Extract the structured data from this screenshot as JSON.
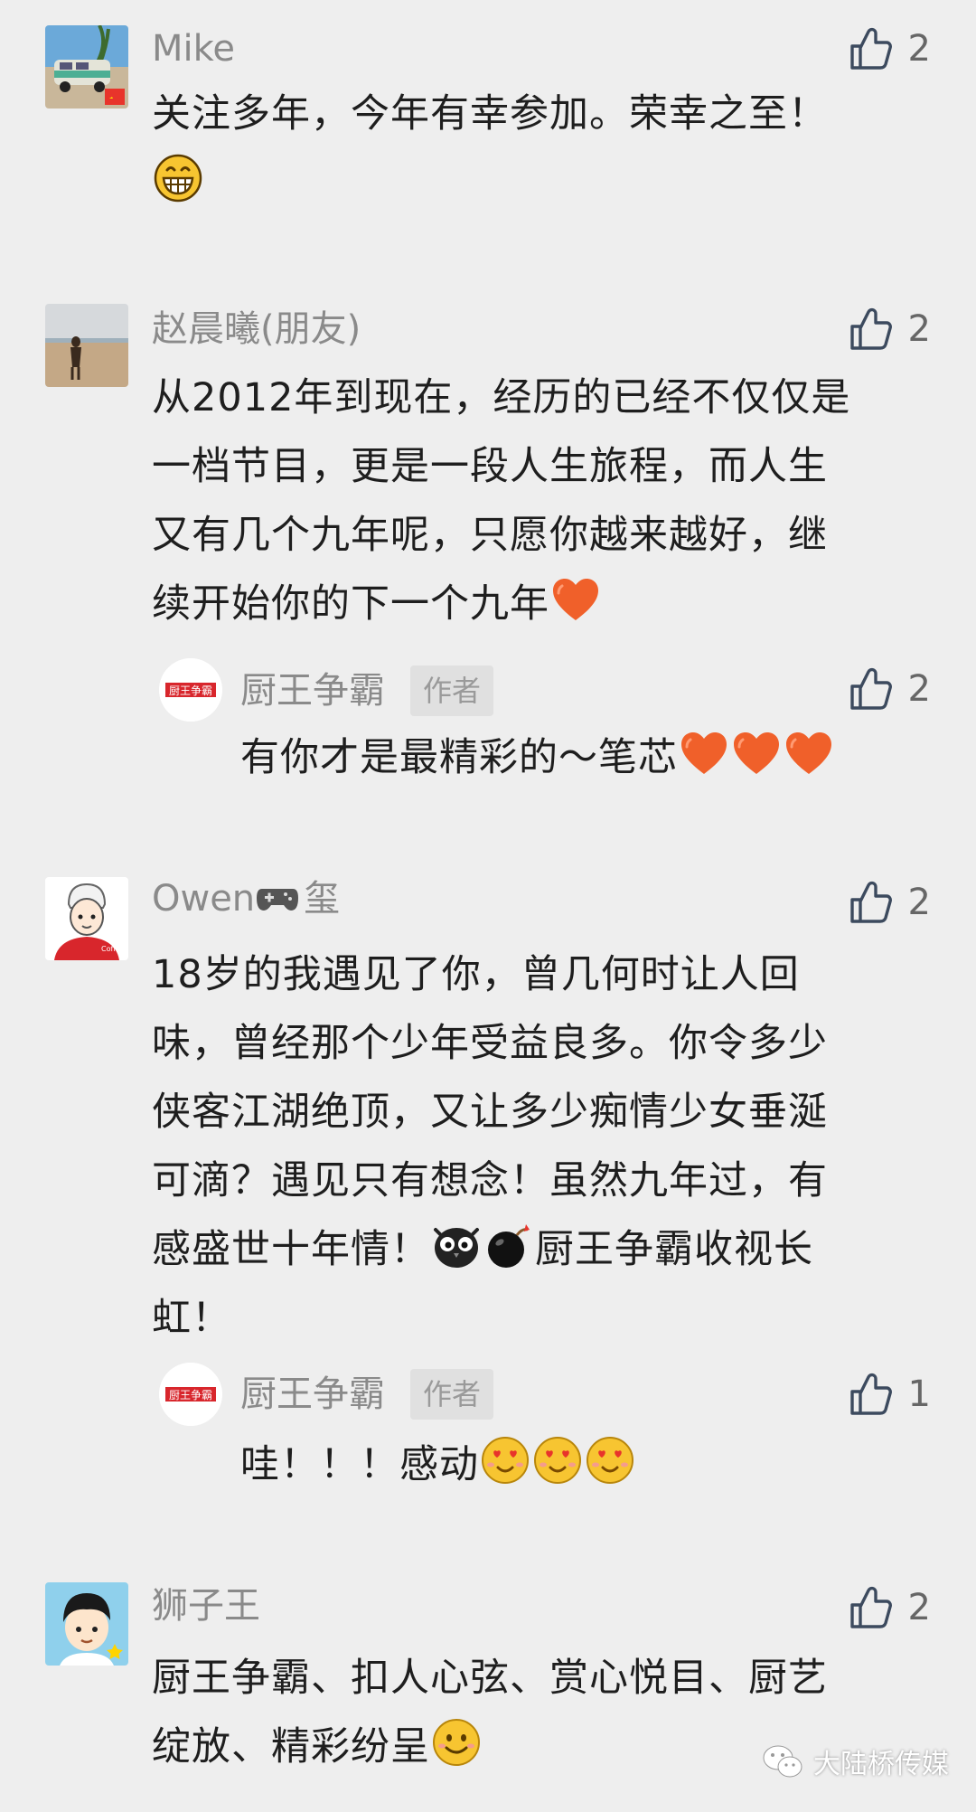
{
  "comments": [
    {
      "name": "Mike",
      "likes": "2",
      "avatar": "van-photo",
      "lines": [
        "关注多年，今年有幸参加。荣幸之至！"
      ],
      "trailing_emoji": "grin-emoji"
    },
    {
      "name": "赵晨曦(朋友)",
      "likes": "2",
      "avatar": "beach-photo",
      "lines": [
        "从2012年到现在，经历的已经不仅仅是",
        "一档节目，更是一段人生旅程，而人生",
        "又有几个九年呢，只愿你越来越好，继",
        "续开始你的下一个九年"
      ],
      "trailing_emoji": "heart-emoji",
      "reply": {
        "name": "厨王争霸",
        "badge": "作者",
        "likes": "2",
        "avatar_text": "厨王争霸",
        "lines": [
          "有你才是最精彩的～笔芯"
        ],
        "trailing_emojis": [
          "heart-emoji",
          "heart-emoji",
          "heart-emoji"
        ]
      }
    },
    {
      "name": "Owen",
      "name_suffix": "玺",
      "likes": "2",
      "avatar": "cartoon-boy-red-shirt",
      "lines": [
        "18岁的我遇见了你，曾几何时让人回",
        "味，曾经那个少年受益良多。你令多少",
        "侠客江湖绝顶，又让多少痴情少女垂涎",
        "可滴？遇见只有想念！虽然九年过，有",
        "感盛世十年情！",
        "虹！"
      ],
      "line5_tail": "厨王争霸收视长",
      "reply": {
        "name": "厨王争霸",
        "badge": "作者",
        "likes": "1",
        "avatar_text": "厨王争霸",
        "lines": [
          "哇！！！感动"
        ],
        "trailing_emojis": [
          "heart-eyes-emoji",
          "heart-eyes-emoji",
          "heart-eyes-emoji"
        ]
      }
    },
    {
      "name": "狮子王",
      "likes": "2",
      "avatar": "cartoon-boy",
      "lines": [
        "厨王争霸、扣人心弦、赏心悦目、厨艺",
        "绽放、精彩纷呈"
      ],
      "trailing_emoji": "smile-emoji"
    }
  ],
  "watermark": "大陆桥传媒",
  "colors": {
    "background": "#eeeeee",
    "name": "#8a8a8a",
    "text": "#1e1e1e",
    "heart": "#f0602a",
    "emoji_yellow": "#f7c531"
  }
}
